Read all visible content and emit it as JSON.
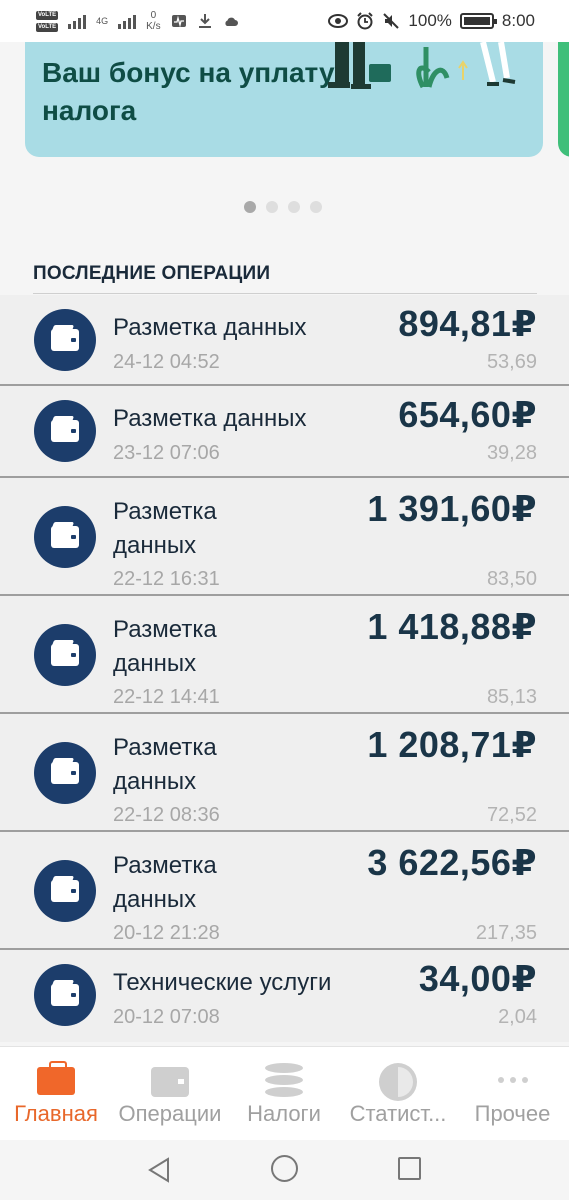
{
  "status_bar": {
    "network_type": "4G",
    "speed_value": "0",
    "speed_unit": "K/s",
    "battery": "100%",
    "time": "8:00"
  },
  "banner": {
    "title": "Ваш бонус на уплату налога"
  },
  "carousel": {
    "page_count": 4,
    "active_index": 0
  },
  "section": {
    "title": "ПОСЛЕДНИЕ ОПЕРАЦИИ"
  },
  "operations": [
    {
      "title": "Разметка данных",
      "date": "24-12 04:52",
      "amount": "894,81₽",
      "tax": "53,69"
    },
    {
      "title": "Разметка данных",
      "date": "23-12 07:06",
      "amount": "654,60₽",
      "tax": "39,28"
    },
    {
      "title": "Разметка данных",
      "date": "22-12 16:31",
      "amount": "1 391,60₽",
      "tax": "83,50"
    },
    {
      "title": "Разметка данных",
      "date": "22-12 14:41",
      "amount": "1 418,88₽",
      "tax": "85,13"
    },
    {
      "title": "Разметка данных",
      "date": "22-12 08:36",
      "amount": "1 208,71₽",
      "tax": "72,52"
    },
    {
      "title": "Разметка данных",
      "date": "20-12 21:28",
      "amount": "3 622,56₽",
      "tax": "217,35"
    },
    {
      "title": "Технические услуги",
      "date": "20-12 07:08",
      "amount": "34,00₽",
      "tax": "2,04"
    }
  ],
  "bottom_nav": {
    "items": [
      {
        "label": "Главная",
        "icon": "briefcase-icon",
        "active": true
      },
      {
        "label": "Операции",
        "icon": "wallet-icon",
        "active": false
      },
      {
        "label": "Налоги",
        "icon": "coins-icon",
        "active": false
      },
      {
        "label": "Статист...",
        "icon": "pie-chart-icon",
        "active": false
      },
      {
        "label": "Прочее",
        "icon": "more-icon",
        "active": false
      }
    ]
  },
  "colors": {
    "accent": "#f0672a",
    "banner_bg": "#a9dce5",
    "banner_text": "#0f4d45",
    "avatar_bg": "#1c3d6b",
    "amount_text": "#1a3548"
  }
}
